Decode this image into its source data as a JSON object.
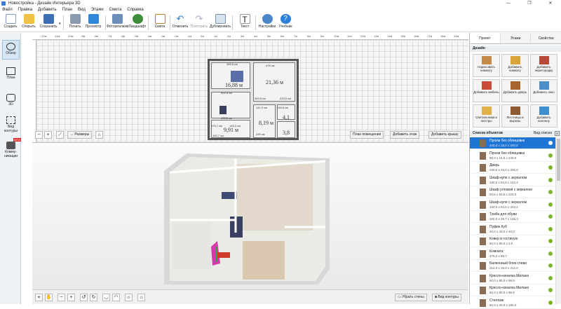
{
  "window": {
    "title": "Новостройка - Дизайн Интерьера 3D",
    "controls": [
      "—",
      "❐",
      "✕"
    ]
  },
  "menu": [
    "Файл",
    "Правка",
    "Добавить",
    "План",
    "Вид",
    "Этажи",
    "Смета",
    "Справка"
  ],
  "toolbar": [
    {
      "label": "Создать",
      "icon": "new-file-icon"
    },
    {
      "label": "Открыть",
      "icon": "folder-open-icon"
    },
    {
      "label": "Сохранить",
      "icon": "save-icon"
    },
    {
      "label": "Печать",
      "icon": "printer-icon"
    },
    {
      "label": "Просмотр",
      "icon": "monitor-icon"
    },
    {
      "label": "Фотореализм",
      "icon": "photo-icon"
    },
    {
      "label": "Ландшафт",
      "icon": "tree-icon"
    },
    {
      "label": "Смета",
      "icon": "estimate-icon"
    },
    {
      "label": "Отменить",
      "icon": "undo-icon"
    },
    {
      "label": "Повторить",
      "icon": "redo-icon"
    },
    {
      "label": "Дублировать",
      "icon": "duplicate-icon"
    },
    {
      "label": "Текст",
      "icon": "text-icon"
    },
    {
      "label": "Настройки",
      "icon": "gear-icon"
    },
    {
      "label": "Учебник",
      "icon": "help-icon"
    }
  ],
  "leftnav": [
    {
      "label": "Обзор",
      "icon": "eye-icon"
    },
    {
      "label": "План",
      "icon": "plan-icon"
    },
    {
      "label": "3D",
      "icon": "cube-icon"
    },
    {
      "label": "Вид контуры",
      "icon": "contour-icon"
    },
    {
      "label": "Комму-никации",
      "icon": "communications-icon",
      "badge": "NEW"
    }
  ],
  "ruler": [
    "-12м",
    "-11м",
    "-10м",
    "-9м",
    "-8м",
    "-7м",
    "-6м",
    "-5м",
    "-4м",
    "-3м",
    "-2м",
    "-1м",
    "0м",
    "1м",
    "2м",
    "3м",
    "4м",
    "5м",
    "6м",
    "7м",
    "8м",
    "9м",
    "10м",
    "11м",
    "12м",
    "13м",
    "14м",
    "15м",
    "16м",
    "17м",
    "18м",
    "19м"
  ],
  "plan": {
    "dims": [
      "385,5 см",
      "476 см",
      "502,8 см",
      "349,5 см",
      "229,5 см",
      "490,5 см",
      "175,7 см",
      "145,3 см",
      "141,9 см",
      "136,6 см",
      "239 см",
      "190,7 см"
    ],
    "areas": [
      "16,88 м",
      "21,36 м",
      "8,19 м",
      "9,91 м",
      "4,1",
      "3,8"
    ],
    "tools": {
      "sizes": "Размеры",
      "rooms": "План помещения",
      "add_floor": "Добавить этаж",
      "add_roof": "Добавить крышу"
    }
  },
  "bottom": {
    "remove_walls": "Убрать стены",
    "contour_view": "Вид контуры"
  },
  "right": {
    "tabs": [
      "Проект",
      "Этажи",
      "Свойства"
    ],
    "design_label": "Дизайн",
    "design_buttons": [
      {
        "label": "Нарисовать комнату",
        "color": "#c68a4a"
      },
      {
        "label": "Добавить комнату",
        "color": "#d9a43a"
      },
      {
        "label": "Добавить перегородку",
        "color": "#b94a3a"
      },
      {
        "label": "Добавить мебель",
        "color": "#c94b3a"
      },
      {
        "label": "Добавить дверь",
        "color": "#a6652e"
      },
      {
        "label": "Добавить окно",
        "color": "#4f8fc9"
      },
      {
        "label": "Светильники и люстры",
        "color": "#e0b04a"
      },
      {
        "label": "Лестницы и вырезы",
        "color": "#8b5a32"
      },
      {
        "label": "Добавить колонну",
        "color": "#3e8fd0"
      }
    ],
    "objects_label": "Список объектов",
    "view_list": "Вид списка",
    "objects": [
      {
        "name": "Проем без облицовки",
        "dim": "240,0 x 15,0 x 240,0",
        "selected": true
      },
      {
        "name": "Проем без облицовки",
        "dim": "90,0 x 15,0 x 240,0"
      },
      {
        "name": "Дверь",
        "dim": "100,0 x 15,0 x 200,0"
      },
      {
        "name": "Шкаф-купе с зеркалом",
        "dim": "100,0 x 64,5 x 222,4"
      },
      {
        "name": "Шкаф угловой с зеркалом",
        "dim": "93,5 x 93,5 x 223,0"
      },
      {
        "name": "Шкаф-купе с зеркалом",
        "dim": "130,0 x 64,5 x 222,4"
      },
      {
        "name": "Тумба для обуви",
        "dim": "100,0 x 29,7 x 125,3"
      },
      {
        "name": "Пуфик Куб",
        "dim": "40,0 x 40,0 x 40,0"
      },
      {
        "name": "Ковер в гостиную",
        "dim": "60,0 x 90,0 x 2,0"
      },
      {
        "name": "Комната",
        "dim": "476,0 x 89,7"
      },
      {
        "name": "Балконный блок слева",
        "dim": "214,0 x 15,0 x 212,0"
      },
      {
        "name": "Кресло-качалка Милано",
        "dim": "60,0 x 99,0 x 99,9"
      },
      {
        "name": "Кресло-качалка Милано",
        "dim": "60,0 x 80,0 x 99,9"
      },
      {
        "name": "Стеллаж",
        "dim": "60,0 x 40,0 x 180,0"
      }
    ]
  }
}
